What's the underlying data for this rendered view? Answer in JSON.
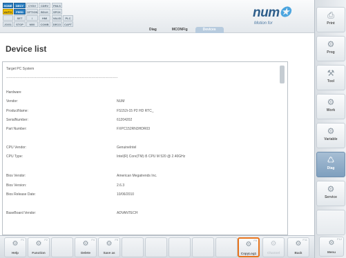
{
  "status": {
    "grid_a": [
      [
        "HOME",
        "DECY",
        "CYDV",
        "CDRV"
      ],
      [
        "AUTO",
        "FEED",
        "OPTION",
        "BDLK"
      ],
      [
        "",
        "SET",
        "/",
        "HMI"
      ],
      [
        "JOG1",
        "STOP",
        "M00",
        "COMB"
      ]
    ],
    "grid_b": [
      [
        "FMLS",
        "",
        ""
      ],
      [
        "SPCK",
        "",
        ""
      ],
      [
        "VALID",
        "PLC",
        ""
      ],
      [
        "DECO",
        "CAPT",
        ""
      ]
    ]
  },
  "logo": {
    "text": "num",
    "mark": "✪",
    "sub": "Motion for"
  },
  "tabs": {
    "diag": "Diag",
    "mconfig": "MCONFig",
    "devices": "Devices"
  },
  "page": {
    "title": "Device list"
  },
  "content": {
    "header": "Target PC System",
    "separator": "-------------------------------------------------------------------------------------------------",
    "rows": [
      {
        "label": "Hardware",
        "value": ""
      },
      {
        "label": "Vendor:",
        "value": "NUM"
      },
      {
        "label": "ProductName:",
        "value": "FS152i-15 P2 HD RTC_"
      },
      {
        "label": "SerialNumber:",
        "value": "61204202"
      },
      {
        "label": "Part Number:",
        "value": "FXPC152RN3HDR03"
      },
      {
        "label": "CPU Vendor:",
        "value": "GenuineIntel"
      },
      {
        "label": "CPU Type:",
        "value": "Intel(R) Core(TM) i5 CPU M 520 @ 2.40GHz"
      },
      {
        "label": "Bios Vendor:",
        "value": "American Megatrends Inc."
      },
      {
        "label": "Bios Version:",
        "value": "2.6.3"
      },
      {
        "label": "Bios Release Date:",
        "value": "10/06/2010"
      },
      {
        "label": "BaseBoard Vendor:",
        "value": "ADVANTECH"
      }
    ]
  },
  "sidebar": {
    "items": [
      {
        "label": "Prog",
        "icon": "✎"
      },
      {
        "label": "Prog",
        "icon": "⚙"
      },
      {
        "label": "Tool",
        "icon": "⚒"
      },
      {
        "label": "Work",
        "icon": "⚙"
      },
      {
        "label": "Variable",
        "icon": "⚙"
      },
      {
        "label": "Diag",
        "icon": "♺"
      },
      {
        "label": "Service",
        "icon": "⚙"
      }
    ],
    "first_label": "Print"
  },
  "softkeys": [
    {
      "label": "Help",
      "num": "F1"
    },
    {
      "label": "Function",
      "num": "F2"
    },
    {
      "label": "Delete",
      "num": "F4"
    },
    {
      "label": "Save as",
      "num": "F5"
    },
    {
      "label": "CopyLog1",
      "num": "F8"
    },
    {
      "label": "Channel",
      "num": ""
    },
    {
      "label": "Back",
      "num": "F11"
    },
    {
      "label": "Menu",
      "num": "F12"
    }
  ],
  "colors": {
    "accent": "#2b7fc2",
    "highlight": "#e8741c",
    "active_tab": "#b7cbde"
  }
}
